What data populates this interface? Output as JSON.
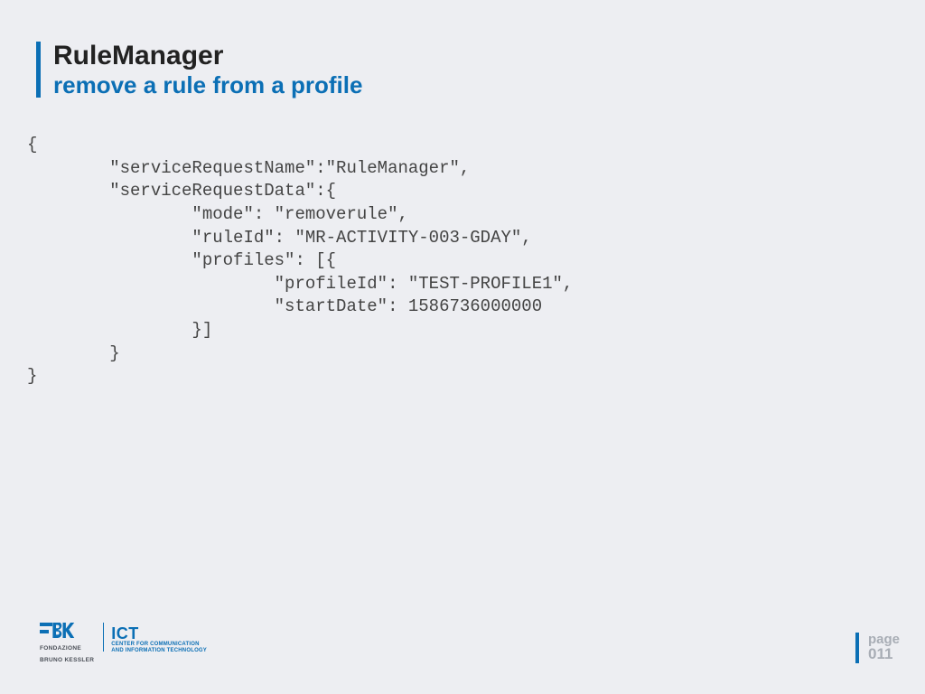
{
  "header": {
    "title": "RuleManager",
    "subtitle": "remove a rule from a profile"
  },
  "code": "{\n        \"serviceRequestName\":\"RuleManager\",\n        \"serviceRequestData\":{\n                \"mode\": \"removerule\",\n                \"ruleId\": \"MR-ACTIVITY-003-GDAY\",\n                \"profiles\": [{\n                        \"profileId\": \"TEST-PROFILE1\",\n                        \"startDate\": 1586736000000\n                }]\n        }\n}",
  "footer": {
    "org_line1": "FONDAZIONE",
    "org_line2": "BRUNO KESSLER",
    "dept": "ICT",
    "dept_line1": "CENTER FOR COMMUNICATION",
    "dept_line2": "AND INFORMATION TECHNOLOGY",
    "page_label": "page",
    "page_number": "011"
  }
}
